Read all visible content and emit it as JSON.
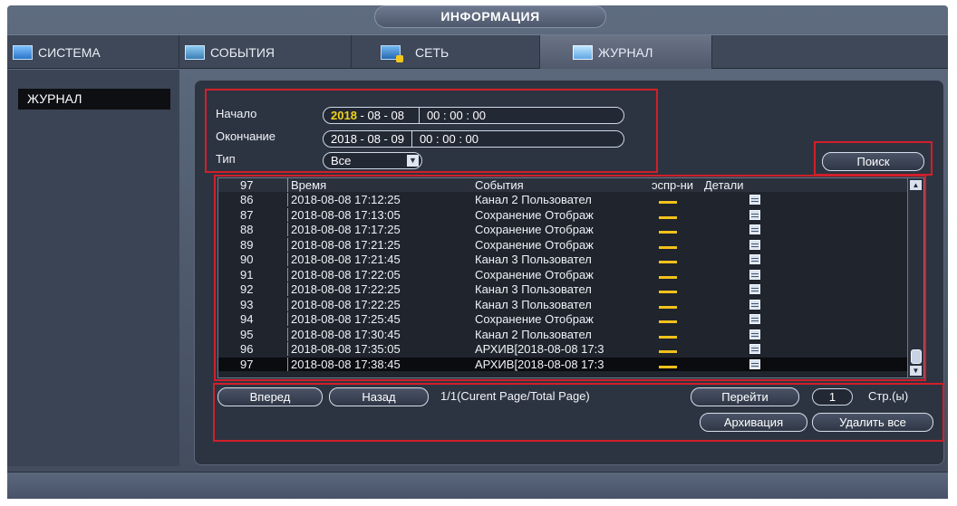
{
  "title": "ИНФОРМАЦИЯ",
  "tabs": [
    {
      "label": "СИСТЕМА",
      "icon": "system-icon"
    },
    {
      "label": "СОБЫТИЯ",
      "icon": "events-icon"
    },
    {
      "label": "СЕТЬ",
      "icon": "network-icon"
    },
    {
      "label": "ЖУРНАЛ",
      "icon": "log-icon",
      "active": true
    }
  ],
  "sidebar": {
    "items": [
      {
        "label": "ЖУРНАЛ",
        "selected": true
      }
    ]
  },
  "filters": {
    "start_label": "Начало",
    "start_date_year": "2018",
    "start_date_rest": " - 08 - 08",
    "start_time": "00 : 00 : 00",
    "end_label": "Окончание",
    "end_date": "2018 - 08 - 09",
    "end_time": "00 : 00 : 00",
    "type_label": "Тип",
    "type_value": "Все"
  },
  "search_button": "Поиск",
  "table": {
    "headers": {
      "no": "97",
      "time": "Время",
      "event": "События",
      "playback": "ɔcпp-ни",
      "details": "Детали"
    },
    "rows": [
      {
        "no": "86",
        "time": "2018-08-08 17:12:25",
        "event": "Канал 2 Пользовател"
      },
      {
        "no": "87",
        "time": "2018-08-08 17:13:05",
        "event": "Сохранение Отображ"
      },
      {
        "no": "88",
        "time": "2018-08-08 17:17:25",
        "event": "Сохранение Отображ"
      },
      {
        "no": "89",
        "time": "2018-08-08 17:21:25",
        "event": "Сохранение Отображ"
      },
      {
        "no": "90",
        "time": "2018-08-08 17:21:45",
        "event": "Канал 3 Пользовател"
      },
      {
        "no": "91",
        "time": "2018-08-08 17:22:05",
        "event": "Сохранение Отображ"
      },
      {
        "no": "92",
        "time": "2018-08-08 17:22:25",
        "event": "Канал 3 Пользовател"
      },
      {
        "no": "93",
        "time": "2018-08-08 17:22:25",
        "event": "Канал 3 Пользовател"
      },
      {
        "no": "94",
        "time": "2018-08-08 17:25:45",
        "event": "Сохранение Отображ"
      },
      {
        "no": "95",
        "time": "2018-08-08 17:30:45",
        "event": "Канал 2 Пользовател"
      },
      {
        "no": "96",
        "time": "2018-08-08 17:35:05",
        "event": "АРХИВ[2018-08-08 17:3"
      },
      {
        "no": "97",
        "time": "2018-08-08 17:38:45",
        "event": "АРХИВ[2018-08-08 17:3",
        "selected": true
      }
    ]
  },
  "pagination": {
    "prev_button": "Вперед",
    "next_button": "Назад",
    "info": "1/1(Curent Page/Total Page)",
    "goto_button": "Перейти",
    "page_value": "1",
    "page_unit": "Стр.(ы)"
  },
  "actions": {
    "archive_button": "Архивация",
    "delete_all_button": "Удалить все"
  },
  "colors": {
    "highlight": "#d21f2a",
    "accent_yellow": "#f2c21b",
    "selected_row": "#0b0c0f"
  }
}
